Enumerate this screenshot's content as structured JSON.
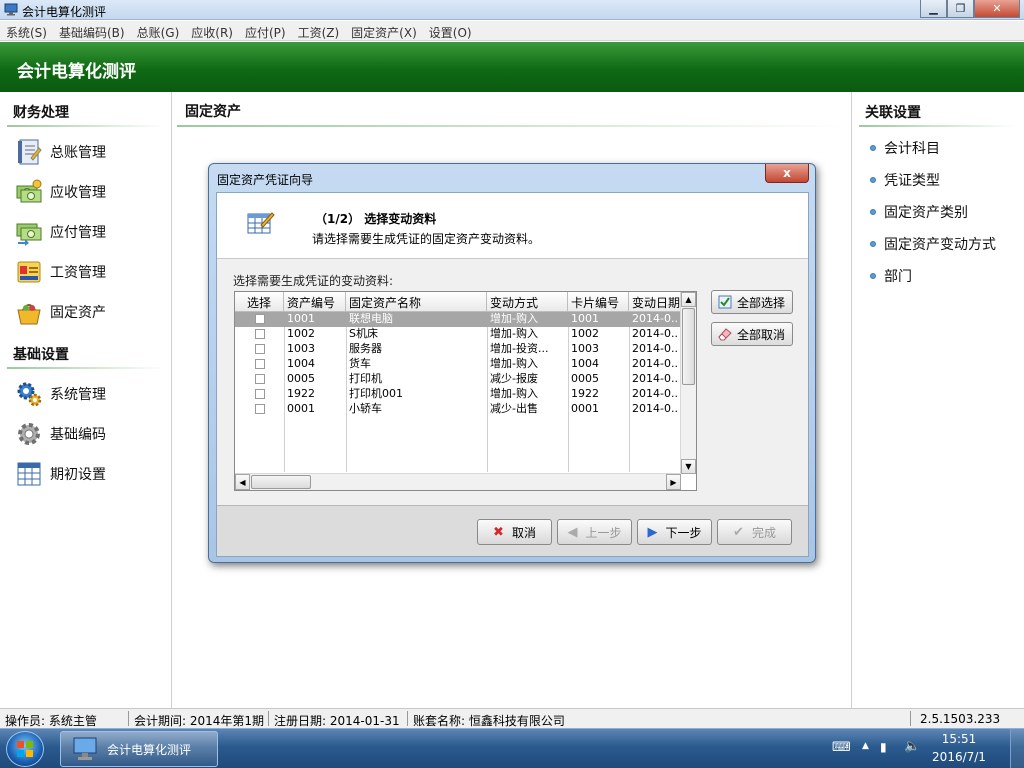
{
  "window": {
    "title": "会计电算化测评"
  },
  "menu": [
    "系统(S)",
    "基础编码(B)",
    "总账(G)",
    "应收(R)",
    "应付(P)",
    "工资(Z)",
    "固定资产(X)",
    "设置(O)"
  ],
  "banner": {
    "title": "会计电算化测评"
  },
  "left": {
    "section1": "财务处理",
    "items1": [
      "总账管理",
      "应收管理",
      "应付管理",
      "工资管理",
      "固定资产"
    ],
    "section2": "基础设置",
    "items2": [
      "系统管理",
      "基础编码",
      "期初设置"
    ]
  },
  "center": {
    "title": "固定资产"
  },
  "right": {
    "title": "关联设置",
    "items": [
      "会计科目",
      "凭证类型",
      "固定资产类别",
      "固定资产变动方式",
      "部门"
    ]
  },
  "dialog": {
    "title": "固定资产凭证向导",
    "close_label": "x",
    "step": "（1/2） 选择变动资料",
    "description": "请选择需要生成凭证的固定资产变动资料。",
    "list_label": "选择需要生成凭证的变动资料:",
    "columns": [
      "选择",
      "资产编号",
      "固定资产名称",
      "变动方式",
      "卡片编号",
      "变动日期"
    ],
    "rows": [
      {
        "code": "1001",
        "name": "联想电脑",
        "method": "增加-购入",
        "card": "1001",
        "date": "2014-0..",
        "selected": true
      },
      {
        "code": "1002",
        "name": "S机床",
        "method": "增加-购入",
        "card": "1002",
        "date": "2014-0.."
      },
      {
        "code": "1003",
        "name": "服务器",
        "method": "增加-投资...",
        "card": "1003",
        "date": "2014-0.."
      },
      {
        "code": "1004",
        "name": "货车",
        "method": "增加-购入",
        "card": "1004",
        "date": "2014-0.."
      },
      {
        "code": "0005",
        "name": "打印机",
        "method": "减少-报废",
        "card": "0005",
        "date": "2014-0.."
      },
      {
        "code": "1922",
        "name": "打印机001",
        "method": "增加-购入",
        "card": "1922",
        "date": "2014-0.."
      },
      {
        "code": "0001",
        "name": "小轿车",
        "method": "减少-出售",
        "card": "0001",
        "date": "2014-0.."
      }
    ],
    "select_all": "全部选择",
    "cancel_all": "全部取消",
    "buttons": {
      "cancel": "取消",
      "prev": "上一步",
      "next": "下一步",
      "finish": "完成"
    }
  },
  "status": {
    "operator": "操作员: 系统主管",
    "period": "会计期间: 2014年第1期",
    "reg_date": "注册日期: 2014-01-31",
    "company": "账套名称: 恒鑫科技有限公司",
    "version": "2.5.1503.233"
  },
  "taskbar": {
    "app": "会计电算化测评",
    "time": "15:51",
    "date": "2016/7/1"
  },
  "colors": {
    "banner": "#0f6a14",
    "accent": "#5b9bd5"
  }
}
